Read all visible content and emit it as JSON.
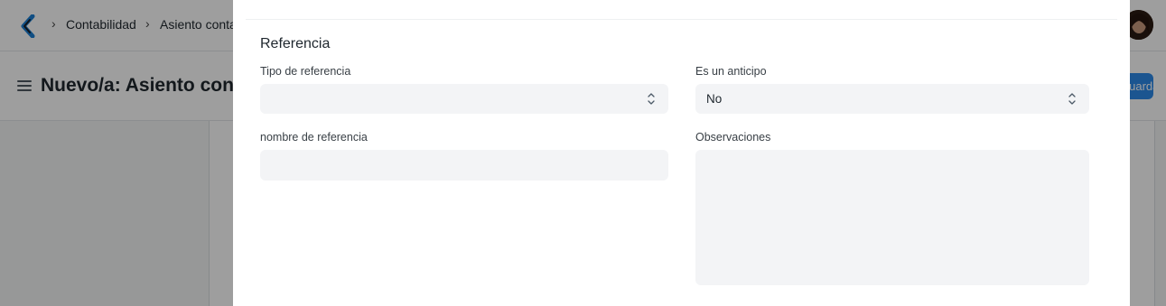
{
  "navbar": {
    "breadcrumbs": [
      "Contabilidad",
      "Asiento conta"
    ]
  },
  "page": {
    "title": "Nuevo/a: Asiento cont",
    "primary_button": "Guardar"
  },
  "modal": {
    "section_title": "Referencia",
    "fields": {
      "reference_type": {
        "label": "Tipo de referencia",
        "value": ""
      },
      "is_advance": {
        "label": "Es un anticipo",
        "value": "No"
      },
      "reference_name": {
        "label": "nombre de referencia",
        "value": ""
      },
      "remarks": {
        "label": "Observaciones",
        "value": ""
      }
    }
  },
  "icons": {
    "logo": "app-logo-icon",
    "menu": "hamburger-icon",
    "select": "chevron-up-down-icon"
  },
  "colors": {
    "accent": "#2d8ae8",
    "input_background": "#f3f4f6"
  }
}
